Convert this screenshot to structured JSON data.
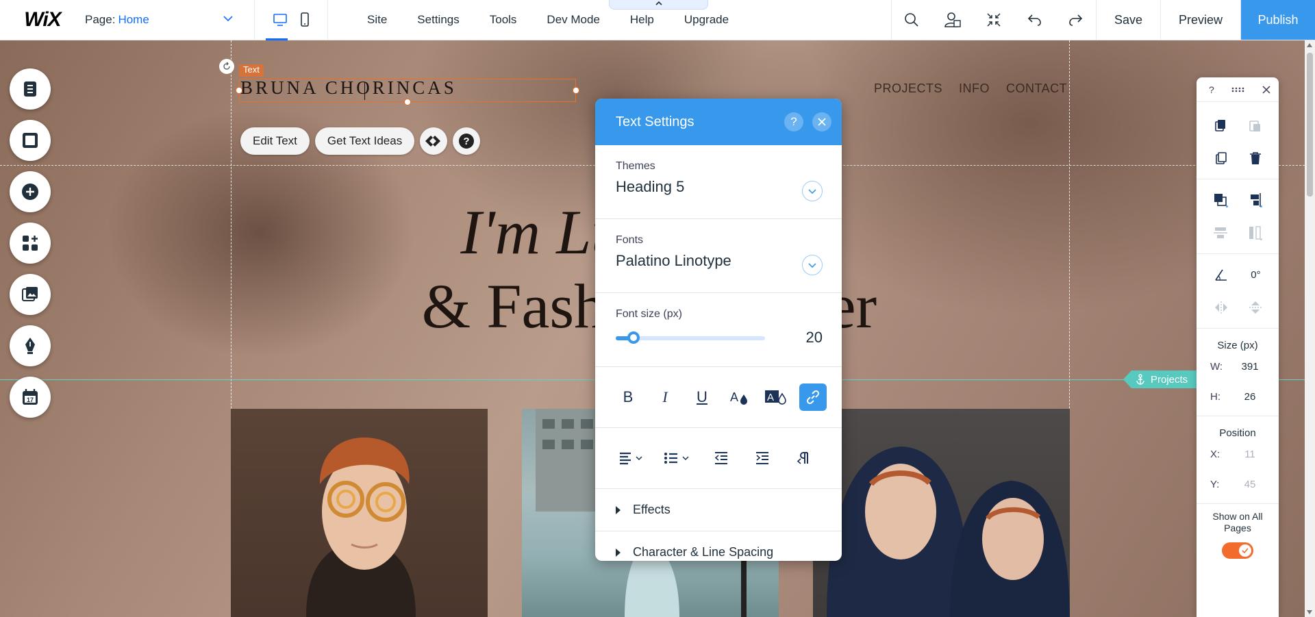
{
  "topbar": {
    "logo": "WiX",
    "page_label": "Page:",
    "page_name": "Home",
    "menu": [
      "Site",
      "Settings",
      "Tools",
      "Dev Mode",
      "Help",
      "Upgrade"
    ],
    "save_label": "Save",
    "preview_label": "Preview",
    "publish_label": "Publish"
  },
  "canvas": {
    "text_tag": "Text",
    "site_title": "BRUNA CHORINCAS",
    "nav": [
      "PROJECTS",
      "INFO",
      "CONTACT"
    ],
    "hero_line1": "I'm Lu           st",
    "hero_line2": "& Fashi           ner",
    "anchor_label": "Projects"
  },
  "edit_toolbar": {
    "edit_text": "Edit Text",
    "get_ideas": "Get Text Ideas"
  },
  "text_settings": {
    "title": "Text Settings",
    "help": "?",
    "themes_label": "Themes",
    "theme_value": "Heading 5",
    "fonts_label": "Fonts",
    "font_value": "Palatino Linotype",
    "font_size_label": "Font size (px)",
    "font_size": "20",
    "font_size_fraction": 0.12,
    "format": {
      "bold": "B",
      "italic": "I",
      "underline": "U"
    },
    "effects_label": "Effects",
    "spacing_label": "Character & Line Spacing"
  },
  "inspector": {
    "help": "?",
    "rotation": "0°",
    "size_label": "Size (px)",
    "w_label": "W:",
    "w_value": "391",
    "h_label": "H:",
    "h_value": "26",
    "position_label": "Position",
    "x_label": "X:",
    "x_value": "11",
    "y_label": "Y:",
    "y_value": "45",
    "show_all_label": "Show on All Pages",
    "show_all_on": true
  },
  "colors": {
    "accent": "#3899ec",
    "selection": "#e8702a",
    "anchor": "#58c9bf",
    "toggle_on": "#f26c2d"
  }
}
